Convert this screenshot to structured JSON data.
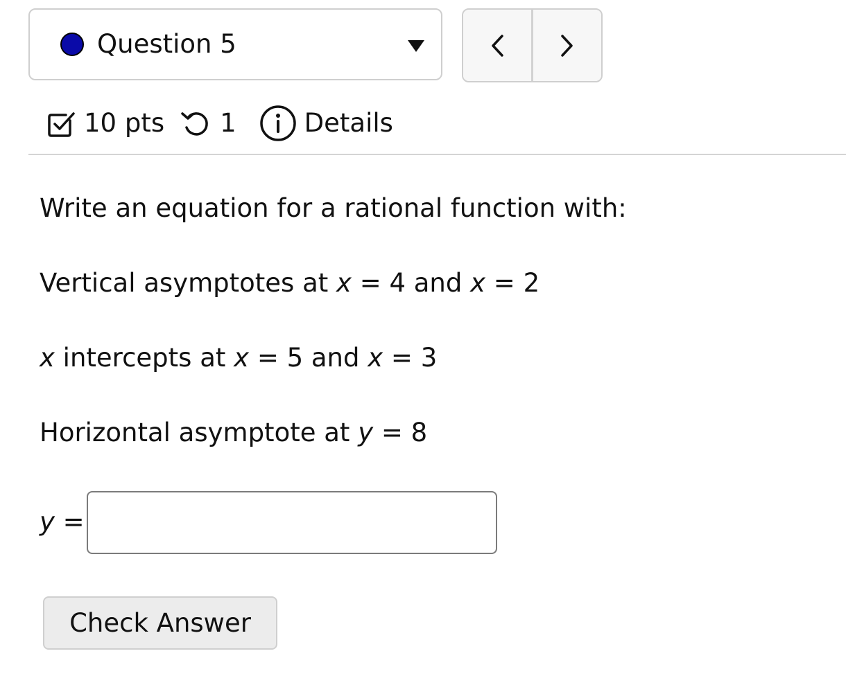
{
  "question_selector": {
    "label": "Question 5",
    "status_color": "#0a0aa8",
    "caret_icon": "caret-down-icon"
  },
  "navigation": {
    "prev_icon": "chevron-left-icon",
    "next_icon": "chevron-right-icon"
  },
  "meta": {
    "points_label": "10 pts",
    "attempts_label": "1",
    "details_label": "Details",
    "icons": [
      "checkbox-icon",
      "retry-icon",
      "info-icon"
    ]
  },
  "question": {
    "prompt": "Write an equation for a rational function with:",
    "vertical_asymptotes": {
      "prefix": "Vertical asymptotes at ",
      "var1": "x",
      "eq1": " = 4 and ",
      "var2": "x",
      "eq2": " = 2"
    },
    "x_intercepts": {
      "var0": "x",
      "text0": " intercepts at ",
      "var1": "x",
      "eq1": " = 5 and ",
      "var2": "x",
      "eq2": " = 3"
    },
    "horizontal_asymptote": {
      "prefix": "Horizontal asymptote at ",
      "var": "y",
      "eq": " = 8"
    }
  },
  "answer": {
    "label_var": "y",
    "label_eq": " =",
    "value": ""
  },
  "check_button_label": "Check Answer"
}
